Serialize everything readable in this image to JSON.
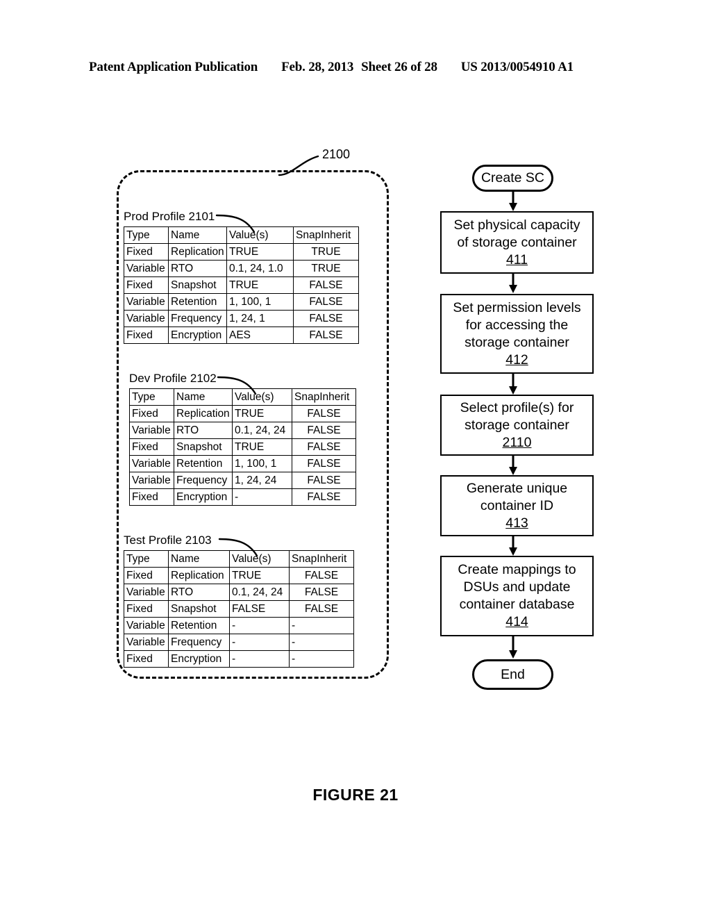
{
  "header": {
    "publication": "Patent Application Publication",
    "date": "Feb. 28, 2013",
    "sheet": "Sheet 26 of 28",
    "patent_number": "US 2013/0054910 A1"
  },
  "figure": {
    "caption": "FIGURE 21",
    "group_ref": "2100"
  },
  "profiles": [
    {
      "label": "Prod Profile 2101",
      "columns": [
        "Type",
        "Name",
        "Value(s)",
        "SnapInherit"
      ],
      "rows": [
        [
          "Fixed",
          "Replication",
          "TRUE",
          "TRUE"
        ],
        [
          "Variable",
          "RTO",
          "0.1, 24, 1.0",
          "TRUE"
        ],
        [
          "Fixed",
          "Snapshot",
          "TRUE",
          "FALSE"
        ],
        [
          "Variable",
          "Retention",
          "1, 100, 1",
          "FALSE"
        ],
        [
          "Variable",
          "Frequency",
          "1, 24, 1",
          "FALSE"
        ],
        [
          "Fixed",
          "Encryption",
          "AES",
          "FALSE"
        ]
      ]
    },
    {
      "label": "Dev Profile 2102",
      "columns": [
        "Type",
        "Name",
        "Value(s)",
        "SnapInherit"
      ],
      "rows": [
        [
          "Fixed",
          "Replication",
          "TRUE",
          "FALSE"
        ],
        [
          "Variable",
          "RTO",
          "0.1, 24, 24",
          "FALSE"
        ],
        [
          "Fixed",
          "Snapshot",
          "TRUE",
          "FALSE"
        ],
        [
          "Variable",
          "Retention",
          "1, 100, 1",
          "FALSE"
        ],
        [
          "Variable",
          "Frequency",
          "1, 24, 24",
          "FALSE"
        ],
        [
          "Fixed",
          "Encryption",
          "-",
          "FALSE"
        ]
      ]
    },
    {
      "label": "Test Profile 2103",
      "columns": [
        "Type",
        "Name",
        "Value(s)",
        "SnapInherit"
      ],
      "rows": [
        [
          "Fixed",
          "Replication",
          "TRUE",
          "FALSE"
        ],
        [
          "Variable",
          "RTO",
          "0.1, 24, 24",
          "FALSE"
        ],
        [
          "Fixed",
          "Snapshot",
          "FALSE",
          "FALSE"
        ],
        [
          "Variable",
          "Retention",
          "-",
          "-"
        ],
        [
          "Variable",
          "Frequency",
          "-",
          "-"
        ],
        [
          "Fixed",
          "Encryption",
          "-",
          "-"
        ]
      ]
    }
  ],
  "flowchart": {
    "start": {
      "label": "Create SC"
    },
    "end": {
      "label": "End"
    },
    "steps": [
      {
        "lines": [
          "Set physical capacity",
          "of storage container"
        ],
        "ref": "411"
      },
      {
        "lines": [
          "Set permission levels",
          "for accessing the",
          "storage container"
        ],
        "ref": "412"
      },
      {
        "lines": [
          "Select profile(s) for",
          "storage container"
        ],
        "ref": "2110"
      },
      {
        "lines": [
          "Generate unique",
          "container ID"
        ],
        "ref": "413"
      },
      {
        "lines": [
          "Create mappings to",
          "DSUs and update",
          "container database"
        ],
        "ref": "414"
      }
    ]
  }
}
